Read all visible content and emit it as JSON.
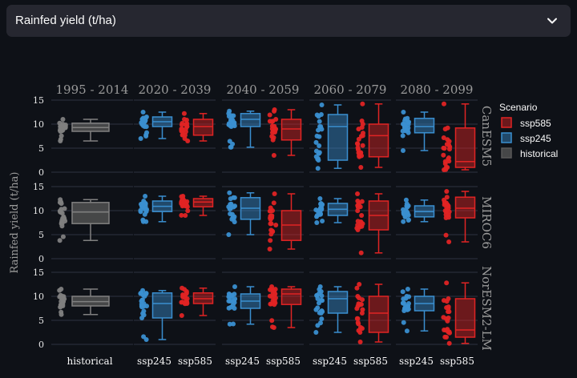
{
  "select": {
    "label": "Rainfed yield (t/ha)"
  },
  "chart_data": {
    "type": "box",
    "ylabel": "Rainfed yield (t/ha)",
    "ylim": [
      0,
      15
    ],
    "yticks": [
      0,
      5,
      10,
      15
    ],
    "legend_title": "Scenario",
    "legend_position": "right",
    "colors": {
      "historical": "#595959",
      "ssp245": "#3a8fd0",
      "ssp585": "#e02424"
    },
    "legend": [
      {
        "name": "ssp585",
        "color": "#e02424"
      },
      {
        "name": "ssp245",
        "color": "#3a8fd0"
      },
      {
        "name": "historical",
        "color": "#595959"
      }
    ],
    "periods": [
      "1995 - 2014",
      "2020 - 2039",
      "2040 - 2059",
      "2060 - 2079",
      "2080 - 2099"
    ],
    "models": [
      "CanESM5",
      "MIROC6",
      "NorESM2-LM"
    ],
    "x_categories": [
      [
        "historical"
      ],
      [
        "ssp245",
        "ssp585"
      ],
      [
        "ssp245",
        "ssp585"
      ],
      [
        "ssp245",
        "ssp585"
      ],
      [
        "ssp245",
        "ssp585"
      ]
    ],
    "boxes": [
      [
        [
          {
            "scenario": "historical",
            "min": 6.5,
            "q1": 8.5,
            "median": 9.3,
            "q3": 10.2,
            "max": 11.0
          }
        ],
        [
          {
            "scenario": "ssp245",
            "min": 7.0,
            "q1": 9.5,
            "median": 10.5,
            "q3": 11.5,
            "max": 12.5
          },
          {
            "scenario": "ssp585",
            "min": 6.5,
            "q1": 7.7,
            "median": 9.5,
            "q3": 11.0,
            "max": 12.2
          }
        ],
        [
          {
            "scenario": "ssp245",
            "min": 5.2,
            "q1": 9.5,
            "median": 11.0,
            "q3": 12.2,
            "max": 12.7
          },
          {
            "scenario": "ssp585",
            "min": 3.5,
            "q1": 6.7,
            "median": 9.0,
            "q3": 11.0,
            "max": 13.0
          }
        ],
        [
          {
            "scenario": "ssp245",
            "min": 0.8,
            "q1": 2.5,
            "median": 9.5,
            "q3": 12.0,
            "max": 14.0
          },
          {
            "scenario": "ssp585",
            "min": 1.0,
            "q1": 3.2,
            "median": 7.6,
            "q3": 10.0,
            "max": 14.2
          }
        ],
        [
          {
            "scenario": "ssp245",
            "min": 4.5,
            "q1": 8.2,
            "median": 9.5,
            "q3": 11.2,
            "max": 12.5
          },
          {
            "scenario": "ssp585",
            "min": 0.5,
            "q1": 1.0,
            "median": 2.2,
            "q3": 9.2,
            "max": 14.2
          }
        ]
      ],
      [
        [
          {
            "scenario": "historical",
            "min": 3.8,
            "q1": 7.3,
            "median": 9.7,
            "q3": 11.7,
            "max": 12.3
          }
        ],
        [
          {
            "scenario": "ssp245",
            "min": 7.7,
            "q1": 9.8,
            "median": 10.9,
            "q3": 12.0,
            "max": 13.0
          },
          {
            "scenario": "ssp585",
            "min": 9.0,
            "q1": 10.8,
            "median": 11.8,
            "q3": 12.5,
            "max": 13.0
          }
        ],
        [
          {
            "scenario": "ssp245",
            "min": 5.0,
            "q1": 8.2,
            "median": 10.5,
            "q3": 12.7,
            "max": 13.7
          },
          {
            "scenario": "ssp585",
            "min": 2.0,
            "q1": 3.8,
            "median": 7.0,
            "q3": 10.0,
            "max": 13.5
          }
        ],
        [
          {
            "scenario": "ssp245",
            "min": 7.5,
            "q1": 9.0,
            "median": 10.3,
            "q3": 11.5,
            "max": 12.5
          },
          {
            "scenario": "ssp585",
            "min": 1.2,
            "q1": 6.0,
            "median": 9.0,
            "q3": 12.0,
            "max": 13.5
          }
        ],
        [
          {
            "scenario": "ssp245",
            "min": 7.7,
            "q1": 8.7,
            "median": 9.8,
            "q3": 11.0,
            "max": 12.2
          },
          {
            "scenario": "ssp585",
            "min": 3.5,
            "q1": 8.5,
            "median": 10.5,
            "q3": 12.8,
            "max": 14.0
          }
        ]
      ],
      [
        [
          {
            "scenario": "historical",
            "min": 6.2,
            "q1": 8.0,
            "median": 8.9,
            "q3": 10.0,
            "max": 11.5
          }
        ],
        [
          {
            "scenario": "ssp245",
            "min": 1.0,
            "q1": 5.5,
            "median": 8.5,
            "q3": 10.7,
            "max": 11.2
          },
          {
            "scenario": "ssp585",
            "min": 6.0,
            "q1": 8.5,
            "median": 9.5,
            "q3": 10.7,
            "max": 11.7
          }
        ],
        [
          {
            "scenario": "ssp245",
            "min": 4.2,
            "q1": 7.5,
            "median": 9.0,
            "q3": 10.5,
            "max": 12.0
          },
          {
            "scenario": "ssp585",
            "min": 3.5,
            "q1": 8.3,
            "median": 10.5,
            "q3": 11.5,
            "max": 12.0
          }
        ],
        [
          {
            "scenario": "ssp245",
            "min": 2.5,
            "q1": 6.5,
            "median": 9.5,
            "q3": 11.0,
            "max": 12.0
          },
          {
            "scenario": "ssp585",
            "min": 0.5,
            "q1": 2.5,
            "median": 6.5,
            "q3": 10.0,
            "max": 12.5
          }
        ],
        [
          {
            "scenario": "ssp245",
            "min": 2.8,
            "q1": 7.0,
            "median": 8.5,
            "q3": 10.0,
            "max": 11.5
          },
          {
            "scenario": "ssp585",
            "min": 0.2,
            "q1": 1.5,
            "median": 3.0,
            "q3": 9.5,
            "max": 12.8
          }
        ]
      ]
    ]
  }
}
